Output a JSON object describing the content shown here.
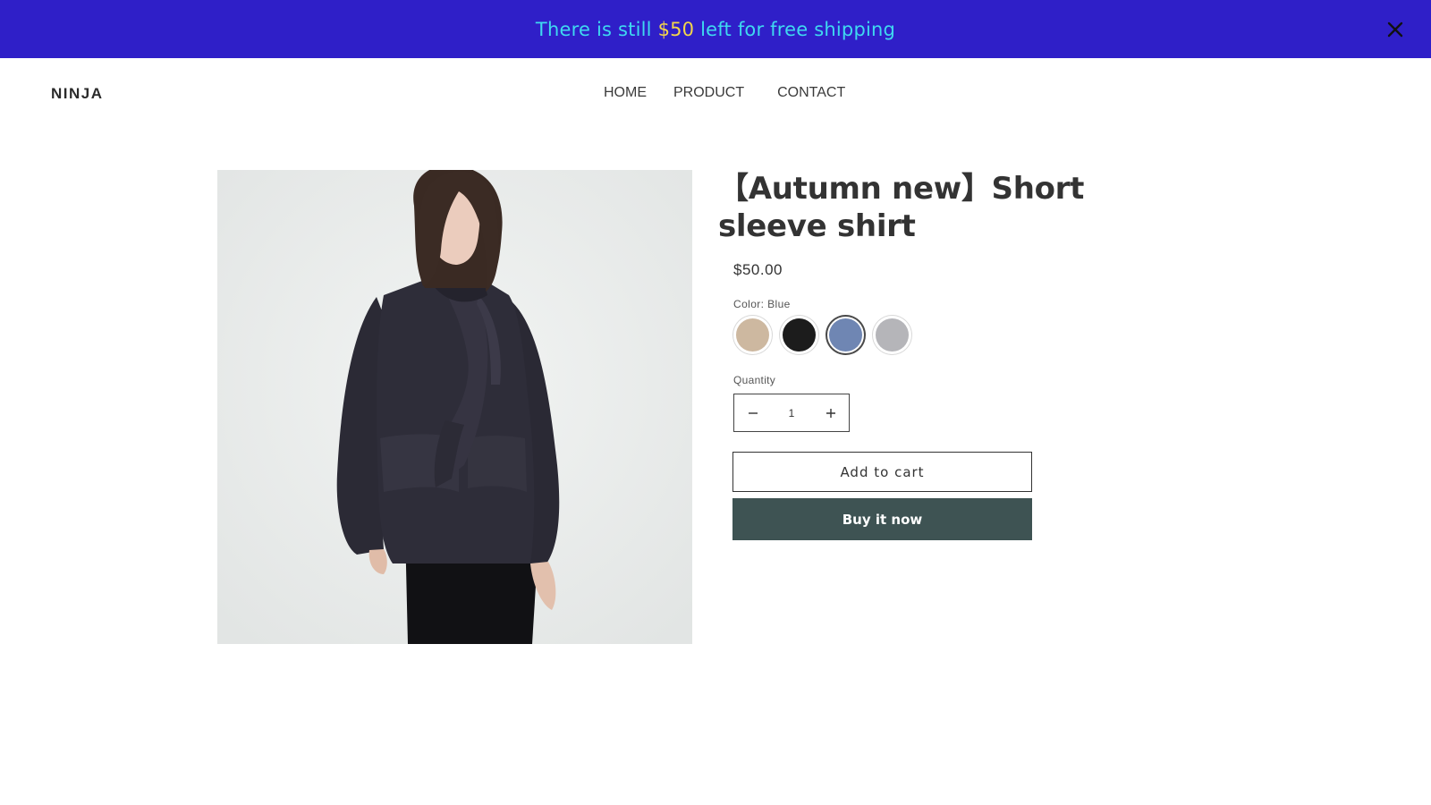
{
  "announcement": {
    "text_before": "There is still ",
    "amount": "$50",
    "text_after": " left for free shipping",
    "colors": {
      "background": "#2f1fc8",
      "text": "#3fd9f0",
      "amount": "#f4d64a"
    },
    "close_icon": "close-icon"
  },
  "header": {
    "logo": "NINJA",
    "nav": {
      "home": "HOME",
      "product": "PRODUCT",
      "contact": "CONTACT"
    }
  },
  "product": {
    "image_alt": "Woman wearing dark navy scarf-collar shirt",
    "title": "【Autumn new】Short sleeve shirt",
    "price": "$50.00",
    "color_label": "Color: Blue",
    "selected_color": "Blue",
    "swatches": [
      {
        "name": "Beige",
        "color": "#cdb8a0"
      },
      {
        "name": "Black",
        "color": "#1c1c1c"
      },
      {
        "name": "Blue",
        "color": "#6f86b3"
      },
      {
        "name": "Gray",
        "color": "#b5b5b9"
      }
    ],
    "quantity_label": "Quantity",
    "quantity_value": "1",
    "add_to_cart": "Add to cart",
    "buy_now": "Buy it now",
    "buy_button_color": "#3e5353"
  }
}
